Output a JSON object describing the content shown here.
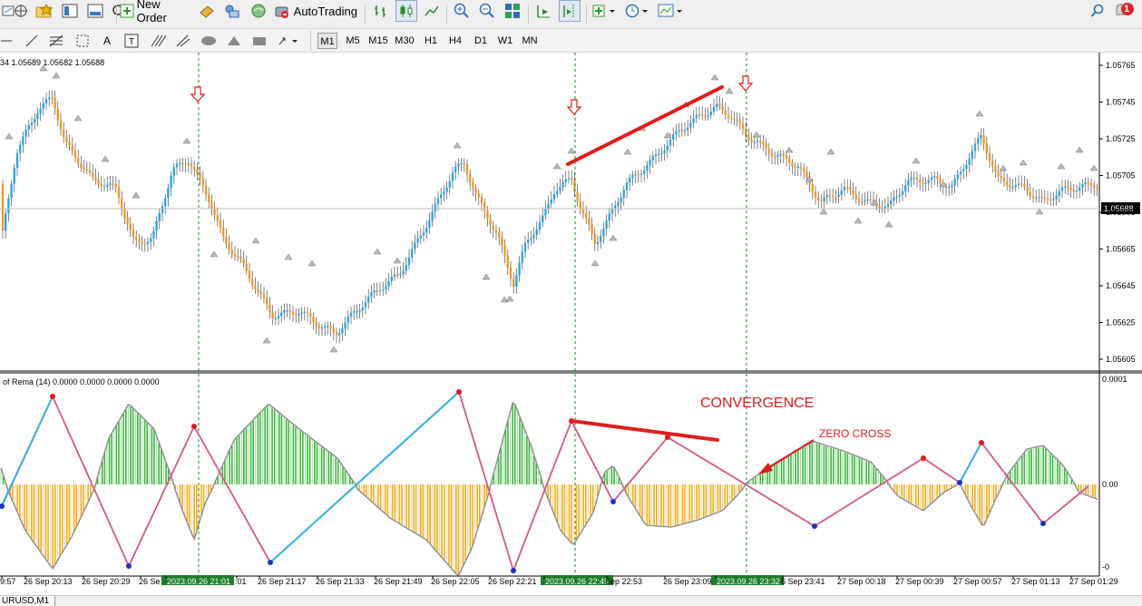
{
  "toolbar": {
    "new_order_label": "New Order",
    "autotrading_label": "AutoTrading",
    "timeframes": [
      "M1",
      "M5",
      "M15",
      "M30",
      "H1",
      "H4",
      "D1",
      "W1",
      "MN"
    ],
    "active_timeframe": "M1",
    "notification_count": "1"
  },
  "chart": {
    "ohlc_text": "34 1.05689 1.05682 1.05688",
    "indicator_text": "of Rema (14) 0.0000 0.0000 0.0000 0.0000",
    "current_price": "1.05688",
    "convergence_label": "CONVERGENCE",
    "zero_cross_label": "ZERO CROSS",
    "price_axis": [
      "1.05765",
      "1.05745",
      "1.05725",
      "1.05705",
      "1.05685",
      "1.05665",
      "1.05645",
      "1.05625",
      "1.05605"
    ],
    "indicator_axis": [
      "0.0001",
      "0.00",
      "-0"
    ],
    "time_axis": [
      "9:57",
      "26 Sep 20:13",
      "26 Sep 20:29",
      "26 Se",
      "2023.09.26 21:01",
      ":01",
      "26 Sep 21:17",
      "26 Sep 21:33",
      "26 Sep 21:49",
      "26 Sep 22:05",
      "26 Sep 22:21",
      "2023.09.26 22:45",
      "Sep 22:53",
      "26 Sep 23:09",
      "2023.09.26 23:32",
      "6 Sep 23:41",
      "27 Sep 00:18",
      "27 Sep 00:39",
      "27 Sep 00:57",
      "27 Sep 01:13",
      "27 Sep 01:29"
    ],
    "colors": {
      "bull": "#29a8e0",
      "bear": "#f39a1e",
      "hist_green": "#3cb83c",
      "hist_orange": "#f2ad1a",
      "annotation": "#e11b1b",
      "zigzag_pink": "#d7568f",
      "zigzag_blue": "#2fb6e6",
      "vline": "#1e8a1e"
    }
  },
  "statusbar": {
    "symbol_tab": "URUSD,M1"
  }
}
